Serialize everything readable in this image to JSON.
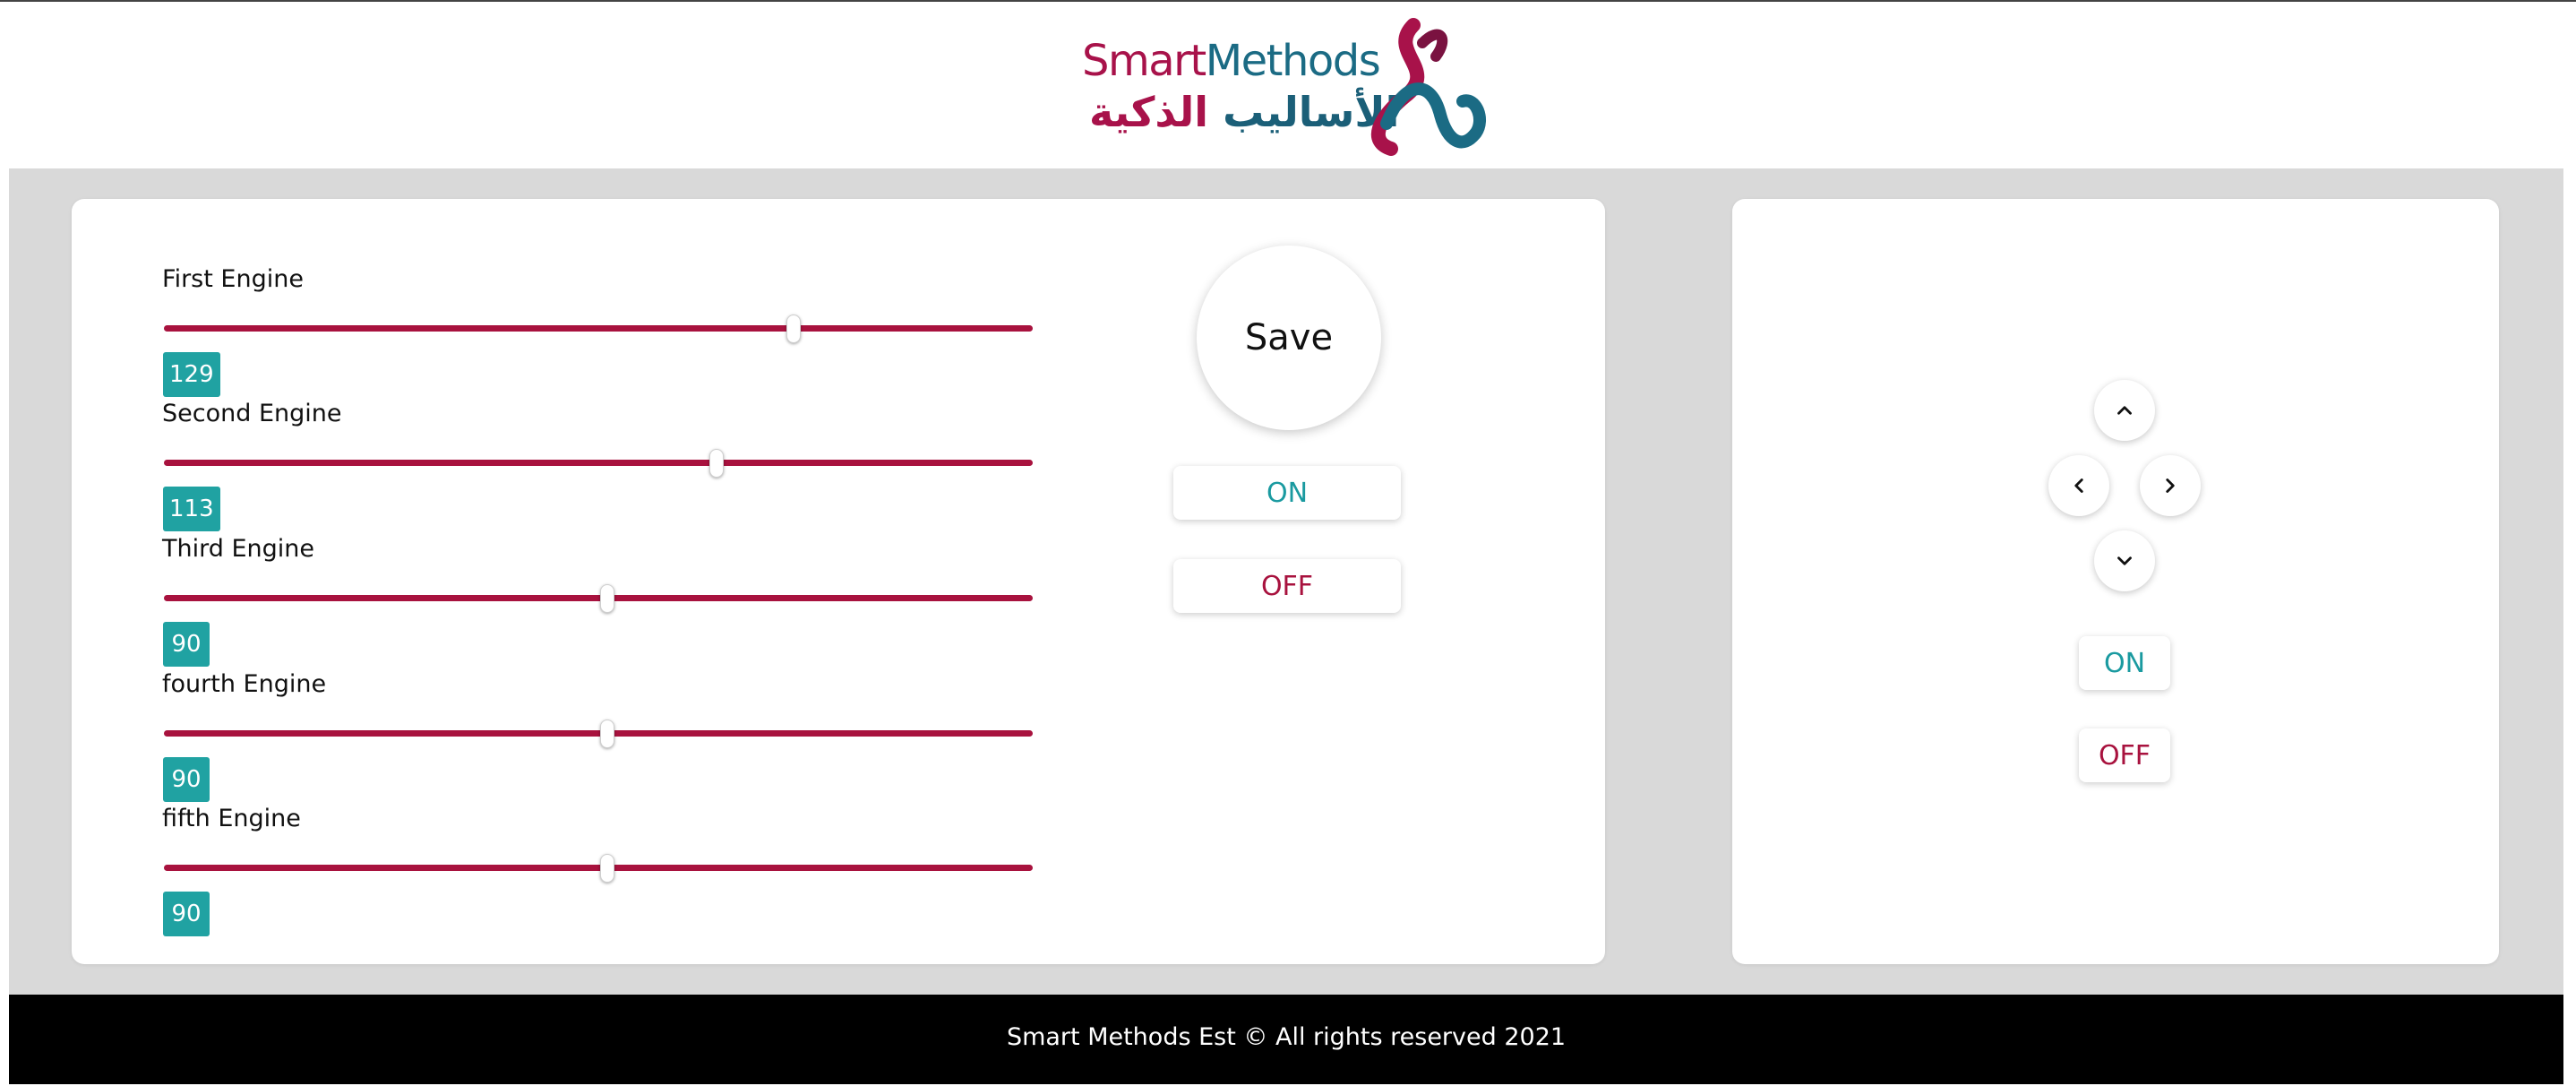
{
  "header": {
    "logo": {
      "text_en_part1": "Smart",
      "text_en_part2": "Methods",
      "text_ar_part1": "الأساليب",
      "text_ar_part2": "الذكية"
    }
  },
  "engines": [
    {
      "label": "First Engine",
      "value": "129",
      "slider_fraction": 0.715
    },
    {
      "label": "Second Engine",
      "value": "113",
      "slider_fraction": 0.628
    },
    {
      "label": "Third Engine",
      "value": "90",
      "slider_fraction": 0.5
    },
    {
      "label": "fourth Engine",
      "value": "90",
      "slider_fraction": 0.5
    },
    {
      "label": "fifth Engine",
      "value": "90",
      "slider_fraction": 0.5
    }
  ],
  "engine_panel": {
    "save_label": "Save",
    "on_label": "ON",
    "off_label": "OFF"
  },
  "control_panel": {
    "directions": [
      "up-arrow-icon",
      "left-arrow-icon",
      "right-arrow-icon",
      "down-arrow-icon"
    ],
    "on_label": "ON",
    "off_label": "OFF"
  },
  "colors": {
    "accent_teal": "#20a2a2",
    "accent_crimson": "#a8123e",
    "background_gray": "#d9d9d9",
    "footer_black": "#000000"
  },
  "footer": {
    "text": "Smart Methods Est © All rights reserved 2021"
  }
}
